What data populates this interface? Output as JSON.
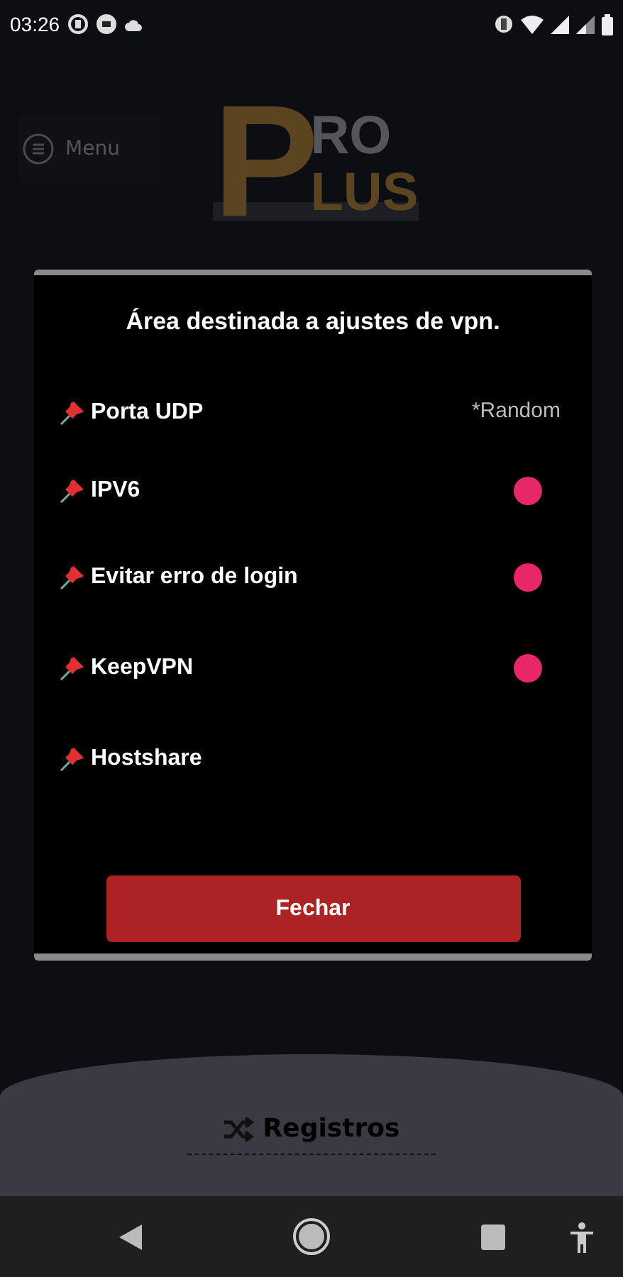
{
  "status_bar": {
    "time": "03:26"
  },
  "header": {
    "menu_label": "Menu",
    "logo": {
      "big_letter": "P",
      "top": "RO",
      "bottom": "LUS"
    }
  },
  "dialog": {
    "title": "Área destinada a ajustes de vpn.",
    "settings": [
      {
        "kind": "select",
        "label": "Porta UDP",
        "value": "*Random"
      },
      {
        "kind": "toggle",
        "label": "IPV6",
        "on": true
      },
      {
        "kind": "toggle",
        "label": "Evitar erro de login",
        "on": true
      },
      {
        "kind": "toggle",
        "label": "KeepVPN",
        "on": true
      },
      {
        "kind": "plain",
        "label": "Hostshare"
      }
    ],
    "button": "Fechar"
  },
  "bottom_panel": {
    "label": "Registros"
  }
}
